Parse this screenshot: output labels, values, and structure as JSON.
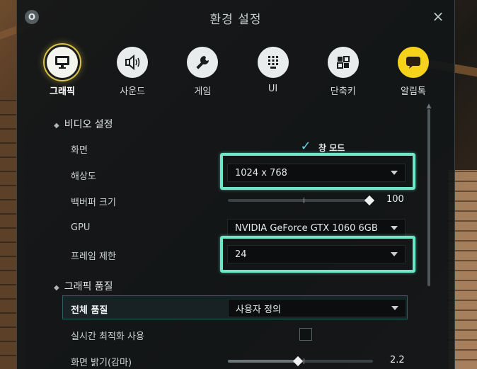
{
  "window": {
    "title": "환경 설정",
    "badge": "O",
    "close_icon": "×"
  },
  "tabs": [
    {
      "label": "그래픽",
      "icon": "monitor-icon",
      "active": true
    },
    {
      "label": "사운드",
      "icon": "speaker-icon",
      "active": false
    },
    {
      "label": "게임",
      "icon": "wrench-icon",
      "active": false
    },
    {
      "label": "UI",
      "icon": "grid-dots-icon",
      "active": false
    },
    {
      "label": "단축키",
      "icon": "shortcut-keys-icon",
      "active": false
    },
    {
      "label": "알림톡",
      "icon": "chat-bubble-icon",
      "active": false
    }
  ],
  "sections": {
    "video": "비디오 설정",
    "quality": "그래픽 품질"
  },
  "video": {
    "screen_label": "화면",
    "window_mode_label": "창 모드",
    "window_mode_checked": true,
    "resolution_label": "해상도",
    "resolution_value": "1024 x 768",
    "backbuffer_label": "백버퍼 크기",
    "backbuffer_value": "100",
    "backbuffer_level": 1.0,
    "gpu_label": "GPU",
    "gpu_value": "NVIDIA GeForce GTX 1060 6GB",
    "framerate_label": "프레임 제한",
    "framerate_value": "24"
  },
  "quality": {
    "overall_label": "전체 품질",
    "overall_value": "사용자 정의",
    "realtime_opt_label": "실시간 최적화 사용",
    "realtime_opt_checked": false,
    "brightness_label": "화면 밝기(감마)",
    "brightness_value": "2.2",
    "brightness_level": 0.5
  },
  "colors": {
    "focus": "#6ee7c9",
    "active_tab_ring": "#d8c24a",
    "check": "#5fd6e4",
    "kakao": "#f6d21b"
  }
}
